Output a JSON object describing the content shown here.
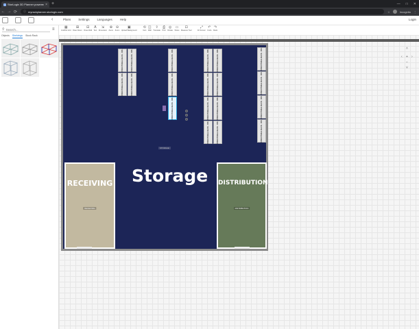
{
  "browser": {
    "tab_title": "StorLogix 3D Planner powered by StorLogix",
    "tab_close": "×",
    "new_tab": "+",
    "url": "myrackplanner.storlogix.com",
    "profile": "Incognito",
    "win_min": "—",
    "win_max": "□",
    "win_close": "✕",
    "back": "←",
    "forward": "→",
    "reload": "⟳",
    "lock": "ⓘ",
    "star": "☆",
    "menu_dots": "⋮"
  },
  "app": {
    "menu": [
      "Plans",
      "Settings",
      "Languages",
      "Help"
    ],
    "login": "Login",
    "collapse": "‹"
  },
  "toolbar": [
    {
      "glyph": "▦",
      "label": "Grid/No Grid"
    },
    {
      "glyph": "⊞",
      "label": "Draw Room"
    },
    {
      "glyph": "⊟",
      "label": "Draw Wall"
    },
    {
      "glyph": "A",
      "label": "Text"
    },
    {
      "glyph": "⇲",
      "label": "Dimension"
    },
    {
      "glyph": "⊕",
      "label": "Zoom"
    },
    {
      "glyph": "⊖",
      "label": "Zoom"
    },
    {
      "glyph": "▣",
      "label": "Upload Background"
    },
    {
      "glyph": "⟲",
      "label": "Vent"
    },
    {
      "glyph": "◫",
      "label": "Wall"
    },
    {
      "glyph": "⇪",
      "label": "Translate"
    },
    {
      "glyph": "⎙",
      "label": "Print"
    },
    {
      "glyph": "◎",
      "label": "Rotate"
    },
    {
      "glyph": "▭",
      "label": "Share"
    },
    {
      "glyph": "⊡",
      "label": "Measure Tool"
    },
    {
      "glyph": "⤢",
      "label": "Fit Screen"
    },
    {
      "glyph": "↶",
      "label": "Undo"
    },
    {
      "glyph": "↷",
      "label": "Redo"
    }
  ],
  "panel": {
    "search_placeholder": "Search...",
    "tabs": [
      "Objects",
      "Shelvings",
      "Stock Rack"
    ],
    "active_tab": 1,
    "menu_glyph": "≡",
    "search_glyph": "⚲"
  },
  "floor": {
    "storage_label": "Storage",
    "storage_tag": "STORAGE",
    "rooms": [
      {
        "key": "recv",
        "label": "RECEIVING",
        "tag": "RECEIVING"
      },
      {
        "key": "dist",
        "label": "DISTRIBUTION",
        "tag": "DISTRIBUTION"
      }
    ],
    "rack_label": "STRUCTURAL RACK - 008 -",
    "colors": {
      "floor": "#1c2557",
      "receiving": "#c2b9a0",
      "distribution": "#667a59",
      "selection": "#2aa9e0"
    }
  },
  "view_controls": {
    "up": "˄",
    "left": "‹",
    "right": "›",
    "down": "˅",
    "zoom_in": "+",
    "zoom_out": "−"
  }
}
